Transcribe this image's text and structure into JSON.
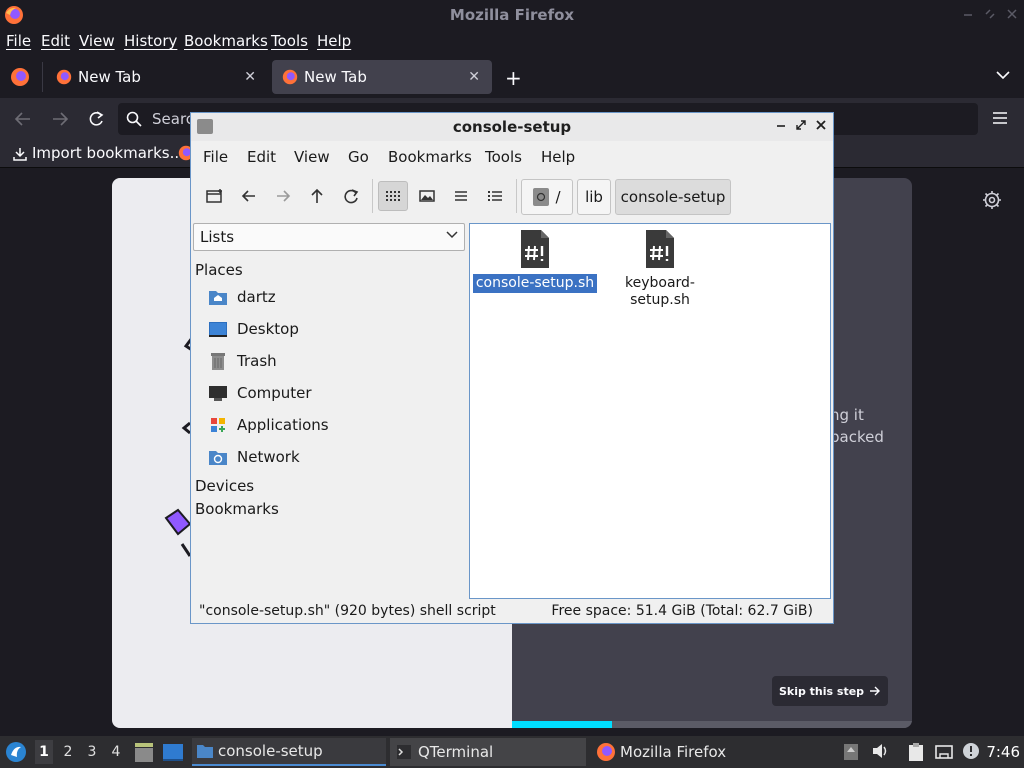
{
  "firefox": {
    "title": "Mozilla Firefox",
    "menu": [
      "File",
      "Edit",
      "View",
      "History",
      "Bookmarks",
      "Tools",
      "Help"
    ],
    "tabs": [
      {
        "label": "New Tab",
        "active": false
      },
      {
        "label": "New Tab",
        "active": true
      }
    ],
    "url_placeholder": "Search",
    "bookmarks_item": "Import bookmarks...",
    "welcome": {
      "fragment_1": "ng it",
      "fragment_2": "packed",
      "skip_label": "Skip this step",
      "progress": 0.25
    }
  },
  "filemanager": {
    "title": "console-setup",
    "menu": [
      "File",
      "Edit",
      "View",
      "Go",
      "Bookmarks",
      "Tools",
      "Help"
    ],
    "breadcrumb": [
      "/",
      "lib",
      "console-setup"
    ],
    "sidebar_mode": "Lists",
    "sections": {
      "places": "Places",
      "devices": "Devices",
      "bookmarks": "Bookmarks"
    },
    "places": [
      {
        "label": "dartz",
        "icon": "home-folder-icon"
      },
      {
        "label": "Desktop",
        "icon": "desktop-icon"
      },
      {
        "label": "Trash",
        "icon": "trash-icon"
      },
      {
        "label": "Computer",
        "icon": "computer-icon"
      },
      {
        "label": "Applications",
        "icon": "applications-icon"
      },
      {
        "label": "Network",
        "icon": "network-icon"
      }
    ],
    "files": [
      {
        "name": "console-setup.sh",
        "selected": true
      },
      {
        "name": "keyboard-\nsetup.sh",
        "selected": false
      }
    ],
    "status_left": "\"console-setup.sh\" (920 bytes) shell script",
    "status_right": "Free space: 51.4 GiB (Total: 62.7 GiB)"
  },
  "taskbar": {
    "workspaces": [
      "1",
      "2",
      "3",
      "4"
    ],
    "tasks": [
      {
        "label": "console-setup"
      },
      {
        "label": "QTerminal"
      },
      {
        "label": "Mozilla Firefox"
      }
    ],
    "clock": "7:46"
  },
  "colors": {
    "accent": "#00ddff",
    "selection": "#3b72c3"
  }
}
